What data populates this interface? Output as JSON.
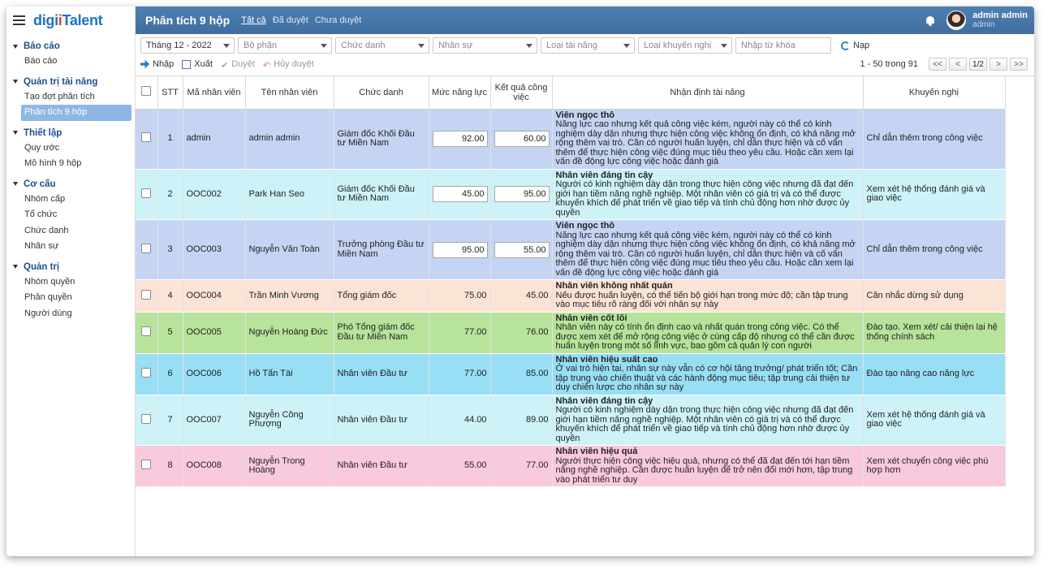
{
  "app": {
    "logo_a": "digi",
    "logo_b": "i",
    "logo_c": "Talent"
  },
  "sidebar": {
    "groups": [
      {
        "label": "Báo cáo",
        "items": [
          "Báo cáo"
        ]
      },
      {
        "label": "Quản trị tài năng",
        "items": [
          "Tạo đợt phân tích",
          "Phân tích 9 hộp"
        ]
      },
      {
        "label": "Thiết lập",
        "items": [
          "Quy ước",
          "Mô hình 9 hộp"
        ]
      },
      {
        "label": "Cơ cấu",
        "items": [
          "Nhóm cấp",
          "Tổ chức",
          "Chức danh",
          "Nhân sự"
        ]
      },
      {
        "label": "Quản trị",
        "items": [
          "Nhóm quyền",
          "Phân quyền",
          "Người dùng"
        ]
      }
    ]
  },
  "header": {
    "title": "Phân tích 9 hộp",
    "tabs": [
      "Tất cả",
      "Đã duyệt",
      "Chưa duyệt"
    ],
    "user_name": "admin admin",
    "user_sub": "admin"
  },
  "filters": {
    "period": "Tháng 12 - 2022",
    "department": "Bộ phận",
    "title": "Chức danh",
    "staff": "Nhân sự",
    "talent_type": "Loại tài năng",
    "recommend_type": "Loại khuyến nghị",
    "keyword_placeholder": "Nhập từ khóa",
    "load": "Nạp"
  },
  "toolbar": {
    "import": "Nhập",
    "export": "Xuất",
    "approve": "Duyệt",
    "unapprove": "Hủy duyệt"
  },
  "pager": {
    "summary": "1 - 50 trong 91",
    "first": "<<",
    "prev": "<",
    "current": "1/2",
    "next": ">",
    "last": ">>"
  },
  "table": {
    "headers": {
      "stt": "STT",
      "code": "Mã nhân viên",
      "name": "Tên nhân viên",
      "title": "Chức danh",
      "capacity": "Mức năng lực",
      "result": "Kết quả công việc",
      "assessment": "Nhận định tài năng",
      "recommend": "Khuyến nghị"
    },
    "rows": [
      {
        "stt": "1",
        "code": "admin",
        "name": "admin admin",
        "title": "Giám đốc Khối Đầu tư Miền Nam",
        "capacity": "92.00",
        "result": "60.00",
        "editable": true,
        "assess_title": "Viên ngọc thô",
        "assess_desc": "Năng lực cao nhưng kết quả công việc kém, người này có thể có kinh nghiệm dày dặn nhưng thực hiện công việc không ổn định, có khả năng mở rộng thêm vai trò. Cần có người huấn luyện, chỉ dẫn thực hiện và cố vấn thêm để thực hiện công việc đúng mục tiêu theo yêu cầu. Hoặc cần xem lại vấn đề động lực công việc hoặc đánh giá",
        "recommend": "Chỉ dẫn thêm trong công việc",
        "color": "#c5d4f3"
      },
      {
        "stt": "2",
        "code": "OOC002",
        "name": "Park Han Seo",
        "title": "Giám đốc Khối Đầu tư Miền Nam",
        "capacity": "45.00",
        "result": "95.00",
        "editable": true,
        "assess_title": "Nhân viên đáng tin cậy",
        "assess_desc": "Người có kinh nghiệm dày dặn trong thực hiện công việc nhưng đã đạt đến giới hạn tiềm năng nghề nghiệp. Một nhân viên có giá trị và có thể được khuyến khích để phát triển về giao tiếp và tính chủ động hơn nhờ được ủy quyền",
        "recommend": "Xem xét hệ thống đánh giá và giao việc",
        "color": "#cdf2f8"
      },
      {
        "stt": "3",
        "code": "OOC003",
        "name": "Nguyễn Văn Toàn",
        "title": "Trưởng phòng Đầu tư Miền Nam",
        "capacity": "95.00",
        "result": "55.00",
        "editable": true,
        "assess_title": "Viên ngọc thô",
        "assess_desc": "Năng lực cao nhưng kết quả công việc kém, người này có thể có kinh nghiệm dày dặn nhưng thực hiện công việc không ổn định, có khả năng mở rộng thêm vai trò. Cần có người huấn luyện, chỉ dẫn thực hiện và cố vấn thêm để thực hiện công việc đúng mục tiêu theo yêu cầu. Hoặc cần xem lại vấn đề động lực công việc hoặc đánh giá",
        "recommend": "Chỉ dẫn thêm trong công việc",
        "color": "#c5d4f3"
      },
      {
        "stt": "4",
        "code": "OOC004",
        "name": "Trần Minh Vương",
        "title": "Tổng giám đốc",
        "capacity": "75.00",
        "result": "45.00",
        "editable": false,
        "assess_title": "Nhân viên không nhất quán",
        "assess_desc": "Nếu được huấn luyện, có thể tiến bộ giới hạn trong mức độ; cần tập trung vào mục tiêu rõ ràng đối với nhân sự này",
        "recommend": "Cân nhắc dừng sử dụng",
        "color": "#fbe3d6"
      },
      {
        "stt": "5",
        "code": "OOC005",
        "name": "Nguyễn Hoàng Đức",
        "title": "Phó Tổng giám đốc Đầu tư Miền Nam",
        "capacity": "77.00",
        "result": "76.00",
        "editable": false,
        "assess_title": "Nhân viên cốt lõi",
        "assess_desc": "Nhân viên này có tính ổn định cao và nhất quán trong công việc. Có thể được xem xét để mở rộng công việc ở cùng cấp độ nhưng có thể cần được huấn luyện trong một số lĩnh vực, bao gồm cả quản lý con người",
        "recommend": "Đào tạo. Xem xét/ cải thiện lại hệ thống chính sách",
        "color": "#b7e39b"
      },
      {
        "stt": "6",
        "code": "OOC006",
        "name": "Hồ Tấn Tài",
        "title": "Nhân viên Đầu tư",
        "capacity": "77.00",
        "result": "85.00",
        "editable": false,
        "assess_title": "Nhân viên hiệu suất cao",
        "assess_desc": "Ở vai trò hiện tại, nhân sự này vẫn có cơ hội tăng trưởng/ phát triển tốt; Cần tập trung vào chiến thuật và các hành động mục tiêu; tập trung cải thiện tư duy chiến lược cho nhân sự này",
        "recommend": "Đào tạo nâng cao năng lực",
        "color": "#98def5"
      },
      {
        "stt": "7",
        "code": "OOC007",
        "name": "Nguyễn Công Phượng",
        "title": "Nhân viên Đầu tư",
        "capacity": "44.00",
        "result": "89.00",
        "editable": false,
        "assess_title": "Nhân viên đáng tin cậy",
        "assess_desc": "Người có kinh nghiệm dày dặn trong thực hiện công việc nhưng đã đạt đến giới hạn tiềm năng nghề nghiệp. Một nhân viên có giá trị và có thể được khuyến khích để phát triển về giao tiếp và tính chủ động hơn nhờ được ủy quyền",
        "recommend": "Xem xét hệ thống đánh giá và giao việc",
        "color": "#cdf2f8"
      },
      {
        "stt": "8",
        "code": "OOC008",
        "name": "Nguyễn Trong Hoàng",
        "title": "Nhân viên Đầu tư",
        "capacity": "55.00",
        "result": "77.00",
        "editable": false,
        "assess_title": "Nhân viên hiệu quả",
        "assess_desc": "Người thực hiện công việc hiệu quả, nhưng có thể đã đạt đến tới hạn tiềm năng nghề nghiệp. Cần được huấn luyện để trở nên đổi mới hơn, tập trung vào phát triển tư duy",
        "recommend": "Xem xét chuyển công việc phù hợp hơn",
        "color": "#f9c9dd"
      }
    ]
  }
}
